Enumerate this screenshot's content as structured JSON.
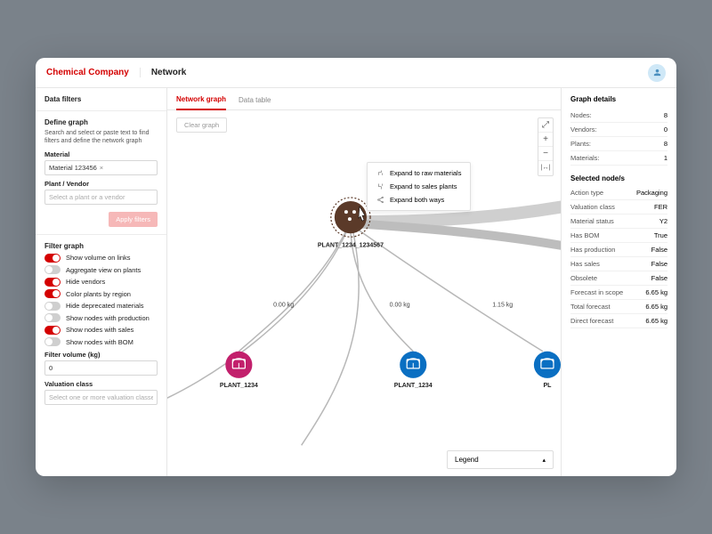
{
  "topbar": {
    "brand": "Chemical Company",
    "nav": "Network"
  },
  "sidebar": {
    "filters_title": "Data filters",
    "define_title": "Define graph",
    "define_help": "Search and select or paste text to find filters and define the network graph",
    "material_label": "Material",
    "material_chip": "Material 123456",
    "plant_label": "Plant / Vendor",
    "plant_placeholder": "Select a plant or a vendor",
    "apply_label": "Apply filters",
    "filter_title": "Filter graph",
    "toggles": [
      {
        "label": "Show volume on links",
        "on": true
      },
      {
        "label": "Aggregate view on plants",
        "on": false
      },
      {
        "label": "Hide vendors",
        "on": true
      },
      {
        "label": "Color plants by region",
        "on": true
      },
      {
        "label": "Hide deprecated materials",
        "on": false
      },
      {
        "label": "Show nodes with production",
        "on": false
      },
      {
        "label": "Show nodes with sales",
        "on": true
      },
      {
        "label": "Show nodes with BOM",
        "on": false
      }
    ],
    "volume_label": "Filter volume (kg)",
    "volume_value": "0",
    "valuation_label": "Valuation class",
    "valuation_placeholder": "Select one or more valuation classes"
  },
  "tabs": {
    "graph": "Network graph",
    "table": "Data table"
  },
  "canvas": {
    "clear": "Clear graph",
    "legend": "Legend",
    "root_label": "PLANT_1234_1234567",
    "nodes": [
      {
        "label": "PLANT_1234",
        "weight": "0.00 kg"
      },
      {
        "label": "PLANT_1234",
        "weight": "0.00 kg"
      },
      {
        "label": "PL",
        "weight": "1.15 kg"
      }
    ],
    "context_menu": [
      "Expand to raw materials",
      "Expand to sales plants",
      "Expand both ways"
    ]
  },
  "details": {
    "graph_title": "Graph details",
    "stats": [
      {
        "k": "Nodes:",
        "v": "8"
      },
      {
        "k": "Vendors:",
        "v": "0"
      },
      {
        "k": "Plants:",
        "v": "8"
      },
      {
        "k": "Materials:",
        "v": "1"
      }
    ],
    "selected_title": "Selected node/s",
    "props": [
      {
        "k": "Action type",
        "v": "Packaging"
      },
      {
        "k": "Valuation class",
        "v": "FER"
      },
      {
        "k": "Material status",
        "v": "Y2"
      },
      {
        "k": "Has BOM",
        "v": "True"
      },
      {
        "k": "Has production",
        "v": "False"
      },
      {
        "k": "Has sales",
        "v": "False"
      },
      {
        "k": "Obsolete",
        "v": "False"
      },
      {
        "k": "Forecast in scope",
        "v": "6.65 kg"
      },
      {
        "k": "Total forecast",
        "v": "6.65 kg"
      },
      {
        "k": "Direct forecast",
        "v": "6.65 kg"
      }
    ]
  }
}
